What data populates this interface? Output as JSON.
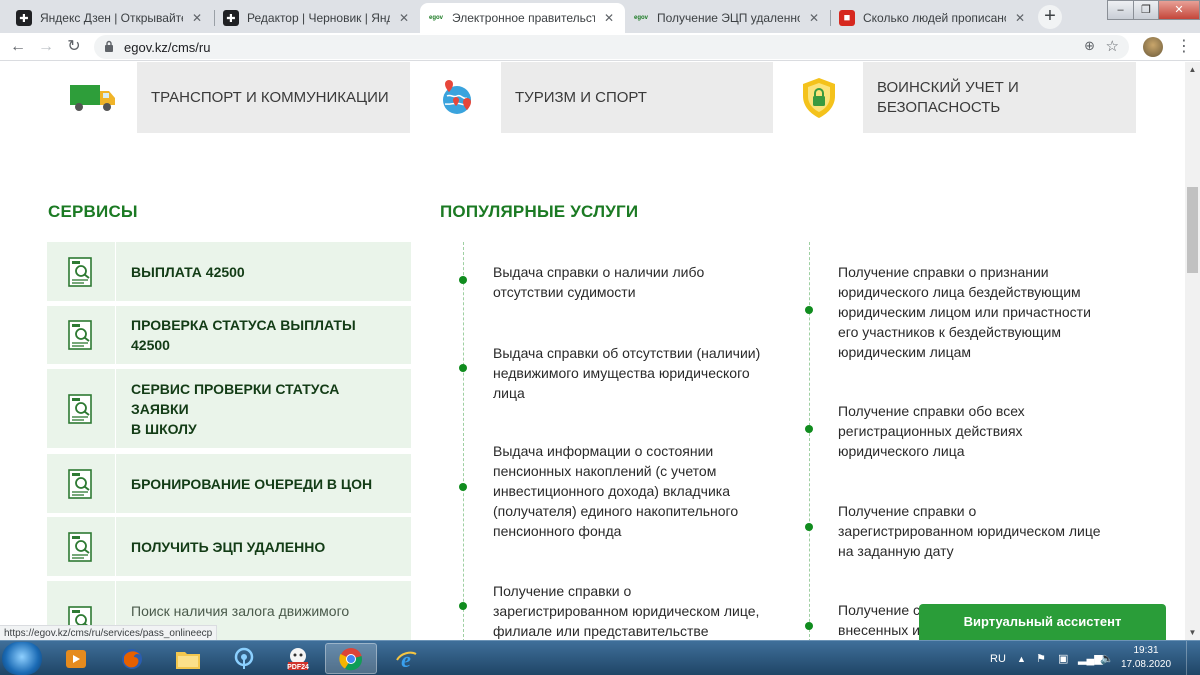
{
  "browser": {
    "tabs": [
      {
        "title": "Яндекс Дзен | Открывайте нов",
        "favicon_text": "",
        "favicon_color": "#202124"
      },
      {
        "title": "Редактор | Черновик | Яндекс Д",
        "favicon_text": "",
        "favicon_color": "#202124"
      },
      {
        "title": "Электронное правительство Р",
        "favicon_text": "egov",
        "favicon_color": "#1b7a23"
      },
      {
        "title": "Получение ЭЦП удаленно | Эл",
        "favicon_text": "egov",
        "favicon_color": "#1b7a23"
      },
      {
        "title": "Сколько людей прописано в к",
        "favicon_text": "",
        "favicon_color": "#d6281f"
      }
    ],
    "url": "egov.kz/cms/ru",
    "status_link": "https://egov.kz/cms/ru/services/pass_onlineecp"
  },
  "categories": [
    {
      "label": "ТРАНСПОРТ И КОММУНИКАЦИИ",
      "icon": "truck-icon"
    },
    {
      "label": "ТУРИЗМ И СПОРТ",
      "icon": "globe-pins-icon"
    },
    {
      "label_line1": "ВОИНСКИЙ УЧЕТ И",
      "label_line2": "БЕЗОПАСНОСТЬ",
      "icon": "shield-lock-icon"
    }
  ],
  "services": {
    "heading": "СЕРВИСЫ",
    "items": [
      {
        "label": "ВЫПЛАТА 42500"
      },
      {
        "label": "ПРОВЕРКА СТАТУСА ВЫПЛАТЫ 42500"
      },
      {
        "label_line1": "СЕРВИС ПРОВЕРКИ СТАТУСА ЗАЯВКИ",
        "label_line2": "В ШКОЛУ"
      },
      {
        "label": "БРОНИРОВАНИЕ ОЧЕРЕДИ В ЦОН"
      },
      {
        "label": "ПОЛУЧИТЬ ЭЦП УДАЛЕННО"
      },
      {
        "label": "Поиск наличия залога движимого"
      }
    ]
  },
  "popular": {
    "heading": "ПОПУЛЯРНЫЕ УСЛУГИ",
    "left": [
      {
        "lines": [
          "Выдача справки о наличии либо",
          "отсутствии судимости"
        ]
      },
      {
        "lines": [
          "Выдача справки об отсутствии (наличии)",
          "недвижимого имущества юридического",
          "лица"
        ]
      },
      {
        "lines": [
          "Выдача информации о состоянии",
          "пенсионных накоплений (с учетом",
          "инвестиционного дохода) вкладчика",
          "(получателя) единого накопительного",
          "пенсионного фонда"
        ]
      },
      {
        "lines": [
          "Получение справки о",
          "зарегистрированном юридическом лице,",
          "филиале или представительстве"
        ]
      }
    ],
    "right": [
      {
        "lines": [
          "Получение справки о признании",
          "юридического лица бездействующим",
          "юридическим лицом или причастности",
          "его участников к бездействующим",
          "юридическим лицам"
        ]
      },
      {
        "lines": [
          "Получение справки обо всех",
          "регистрационных действиях",
          "юридического лица"
        ]
      },
      {
        "lines": [
          "Получение справки о",
          "зарегистрированном юридическом лице",
          "на заданную дату"
        ]
      },
      {
        "lines": [
          "Получение с",
          "внесенных и"
        ]
      }
    ]
  },
  "assistant_label": "Виртуальный ассистент",
  "taskbar": {
    "lang": "RU",
    "time": "19:31",
    "date": "17.08.2020"
  },
  "colors": {
    "brand_green": "#1b7a23",
    "service_bg": "#eaf4ea",
    "assistant_green": "#2a9d39"
  }
}
